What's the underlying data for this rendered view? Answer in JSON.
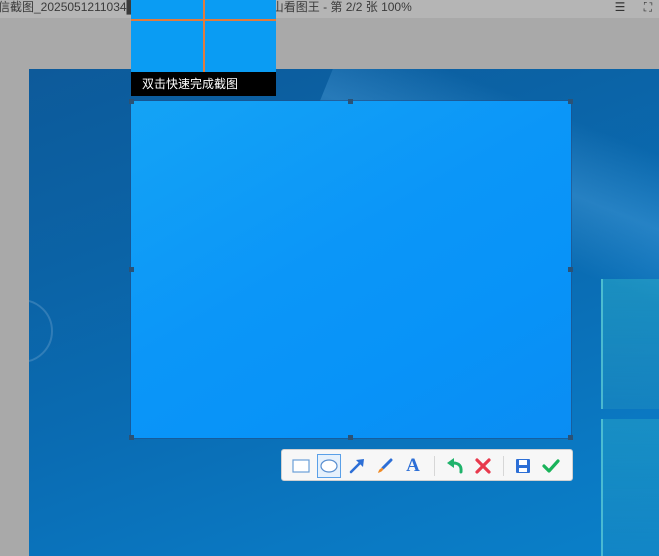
{
  "window": {
    "title": "信截图_2025051211034█████████████B) - 蓝山看图王 - 第 2/2 张 100%",
    "menu_icon": "hamburger-menu-icon",
    "fullscreen_icon": "fullscreen-icon"
  },
  "magnifier": {
    "hint": "双击快速完成截图",
    "crosshair_color": "#e27b3c",
    "preview_color": "#0a9cf3"
  },
  "selection": {
    "fill_color": "#0b96f8",
    "handle_color": "#2b5276"
  },
  "toolbar": {
    "tools": [
      {
        "name": "rectangle-tool",
        "icon": "rectangle-icon",
        "active": false
      },
      {
        "name": "ellipse-tool",
        "icon": "ellipse-icon",
        "active": true
      },
      {
        "name": "arrow-tool",
        "icon": "arrow-icon",
        "active": false
      },
      {
        "name": "brush-tool",
        "icon": "brush-icon",
        "active": false
      },
      {
        "name": "text-tool",
        "icon": "text-icon",
        "label": "A",
        "active": false
      },
      {
        "name": "undo-tool",
        "icon": "undo-icon",
        "active": false
      },
      {
        "name": "cancel-tool",
        "icon": "close-icon",
        "active": false
      },
      {
        "name": "save-tool",
        "icon": "save-icon",
        "active": false
      },
      {
        "name": "confirm-tool",
        "icon": "checkmark-icon",
        "active": false
      }
    ]
  },
  "colors": {
    "accent_blue": "#2d6fd6",
    "undo_green": "#1fb36b",
    "cancel_red": "#e8394d",
    "confirm_green": "#19b35a",
    "brush_orange": "#f08a24"
  }
}
